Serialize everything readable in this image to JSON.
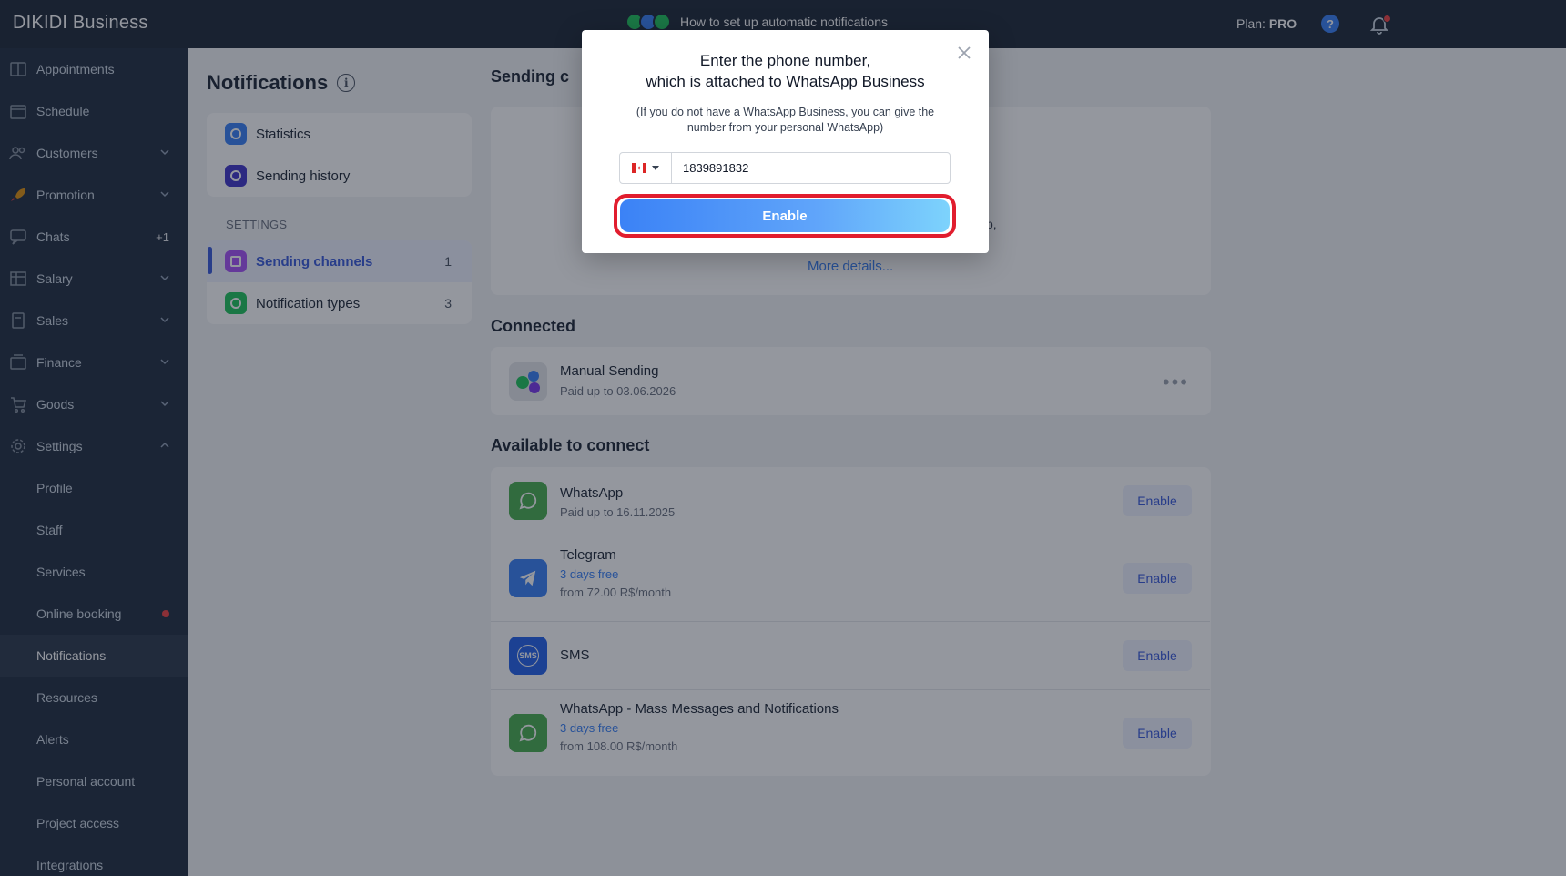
{
  "topbar": {
    "brand": "DIKIDI Business",
    "howto_label": "How to set up automatic notifications",
    "plan_label": "Plan:",
    "plan_value": "PRO",
    "help_symbol": "?"
  },
  "sidebar": {
    "items": [
      {
        "label": "Appointments"
      },
      {
        "label": "Schedule"
      },
      {
        "label": "Customers"
      },
      {
        "label": "Promotion"
      },
      {
        "label": "Chats",
        "badge": "+1"
      },
      {
        "label": "Salary"
      },
      {
        "label": "Sales"
      },
      {
        "label": "Finance"
      },
      {
        "label": "Goods"
      },
      {
        "label": "Settings"
      }
    ],
    "sub_items": [
      {
        "label": "Profile"
      },
      {
        "label": "Staff"
      },
      {
        "label": "Services"
      },
      {
        "label": "Online booking"
      },
      {
        "label": "Notifications"
      },
      {
        "label": "Resources"
      },
      {
        "label": "Alerts"
      },
      {
        "label": "Personal account"
      },
      {
        "label": "Project access"
      },
      {
        "label": "Integrations"
      }
    ]
  },
  "notifications_menu": {
    "title": "Notifications",
    "info_symbol": "i",
    "statistics": "Statistics",
    "history": "Sending history",
    "settings_label": "SETTINGS",
    "channels": {
      "label": "Sending channels",
      "count": "1"
    },
    "types": {
      "label": "Notification types",
      "count": "3"
    }
  },
  "main": {
    "sending_title": "Sending c",
    "partial_text": "p,",
    "more_details": "More details...",
    "connected_title": "Connected",
    "connected": {
      "name": "Manual Sending",
      "sub": "Paid up to 03.06.2026",
      "more": "•••"
    },
    "available_title": "Available to connect",
    "available": [
      {
        "name": "WhatsApp",
        "sub": "Paid up to 16.11.2025",
        "free": "",
        "button": "Enable"
      },
      {
        "name": "Telegram",
        "free": "3 days free",
        "sub": "from 72.00 R$/month",
        "button": "Enable"
      },
      {
        "name": "SMS",
        "free": "",
        "sub": "",
        "button": "Enable"
      },
      {
        "name": "WhatsApp - Mass Messages and Notifications",
        "free": "3 days free",
        "sub": "from 108.00 R$/month",
        "button": "Enable"
      }
    ],
    "sms_icon_text": "SMS"
  },
  "modal": {
    "title_line1": "Enter the phone number,",
    "title_line2": "which is attached to WhatsApp Business",
    "note": "(If you do not have a WhatsApp Business, you can give the number from your personal WhatsApp)",
    "phone_value": "1839891832",
    "enable_label": "Enable"
  },
  "colors": {
    "topbar": "#1f2a3a",
    "sidebar": "#243042",
    "accent": "#3b5bdb",
    "highlight": "#e11d2e"
  }
}
